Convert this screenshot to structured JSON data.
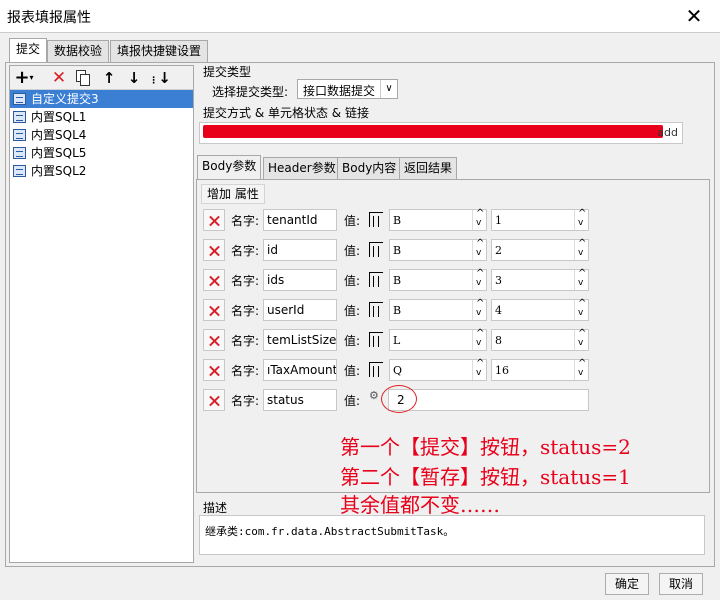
{
  "window": {
    "title": "报表填报属性"
  },
  "top_tabs": [
    {
      "label": "提交"
    },
    {
      "label": "数据校验"
    },
    {
      "label": "填报快捷键设置"
    }
  ],
  "toolbar": {
    "icons": [
      "add-dropdown-icon",
      "delete-icon",
      "copy-icon",
      "move-up-icon",
      "move-down-icon",
      "move-bottom-icon"
    ]
  },
  "tree": {
    "items": [
      {
        "label": "自定义提交3",
        "selected": true
      },
      {
        "label": "内置SQL1"
      },
      {
        "label": "内置SQL4"
      },
      {
        "label": "内置SQL5"
      },
      {
        "label": "内置SQL2"
      }
    ]
  },
  "submit_type": {
    "section_label": "提交类型",
    "select_label": "选择提交类型:",
    "select_value": "接口数据提交"
  },
  "submit_method": {
    "section_label": "提交方式 & 单元格状态 & 链接",
    "url_tail": "add"
  },
  "inner_tabs": [
    {
      "label": "Body参数"
    },
    {
      "label": "Header参数"
    },
    {
      "label": "Body内容"
    },
    {
      "label": "返回结果"
    }
  ],
  "body_params": {
    "add_label": "增加 属性",
    "name_label": "名字:",
    "value_label": "值:",
    "rows": [
      {
        "name": "tenantId",
        "type": "B",
        "value": "1"
      },
      {
        "name": "id",
        "type": "B",
        "value": "2"
      },
      {
        "name": "ids",
        "type": "B",
        "value": "3"
      },
      {
        "name": "userId",
        "type": "B",
        "value": "4"
      },
      {
        "name": "temListSize",
        "type": "L",
        "value": "8"
      },
      {
        "name": "ıTaxAmount",
        "type": "Q",
        "value": "16"
      }
    ],
    "status_row": {
      "name": "status",
      "value": "2"
    }
  },
  "annotation": {
    "lines": [
      "第一个【提交】按钮，status=2",
      "第二个【暂存】按钮，status=1",
      "其余值都不变……"
    ],
    "color": "#e8001a"
  },
  "description": {
    "section_label": "描述",
    "text": "继承类:com.fr.data.AbstractSubmitTask。"
  },
  "footer": {
    "ok_label": "确定",
    "cancel_label": "取消"
  }
}
